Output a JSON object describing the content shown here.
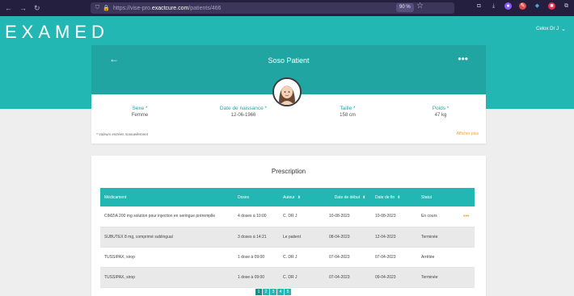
{
  "browser": {
    "url_prefix": "https://vise-pro.",
    "url_host": "exactcure.com",
    "url_path": "/patients/466",
    "zoom": "90 %"
  },
  "header": {
    "logo": "EXAMED",
    "user": "Celox Dr J"
  },
  "patient": {
    "name": "Soso Patient"
  },
  "info": {
    "fields": [
      {
        "label": "Sexe *",
        "value": "Femme"
      },
      {
        "label": "Date de naissance *",
        "value": "12-06-1966"
      },
      {
        "label": "Taille *",
        "value": "158 cm"
      },
      {
        "label": "Poids *",
        "value": "47 kg"
      }
    ],
    "footnote": "* Valeurs entrées manuellement",
    "show_more": "Afficher plus"
  },
  "prescription": {
    "title": "Prescription",
    "columns": {
      "medication": "Médicament",
      "doses": "Doses",
      "author": "Auteur",
      "start_date": "Date de début",
      "end_date": "Date de fin",
      "status": "Statut"
    },
    "rows": [
      {
        "medication": "CIMZIA 200 mg solution pour injection en seringue préremplie",
        "doses": "4 doses à 10:00",
        "author": "C. DR J",
        "start": "10-08-2023",
        "end": "10-08-2023",
        "status": "En cours"
      },
      {
        "medication": "SUBUTEX 8 mg, comprimé sublingual",
        "doses": "3 doses à 14:21",
        "author": "Le patient",
        "start": "08-04-2023",
        "end": "12-04-2023",
        "status": "Terminée"
      },
      {
        "medication": "TUSSIPAX, sirop",
        "doses": "1 dose à 09:00",
        "author": "C. DR J",
        "start": "07-04-2023",
        "end": "07-04-2023",
        "status": "Arrêtée"
      },
      {
        "medication": "TUSSIPAX, sirop",
        "doses": "1 dose à 09:00",
        "author": "C. DR J",
        "start": "07-04-2023",
        "end": "09-04-2023",
        "status": "Terminée"
      }
    ],
    "pages": [
      "1",
      "2",
      "3",
      "4",
      "5"
    ]
  }
}
